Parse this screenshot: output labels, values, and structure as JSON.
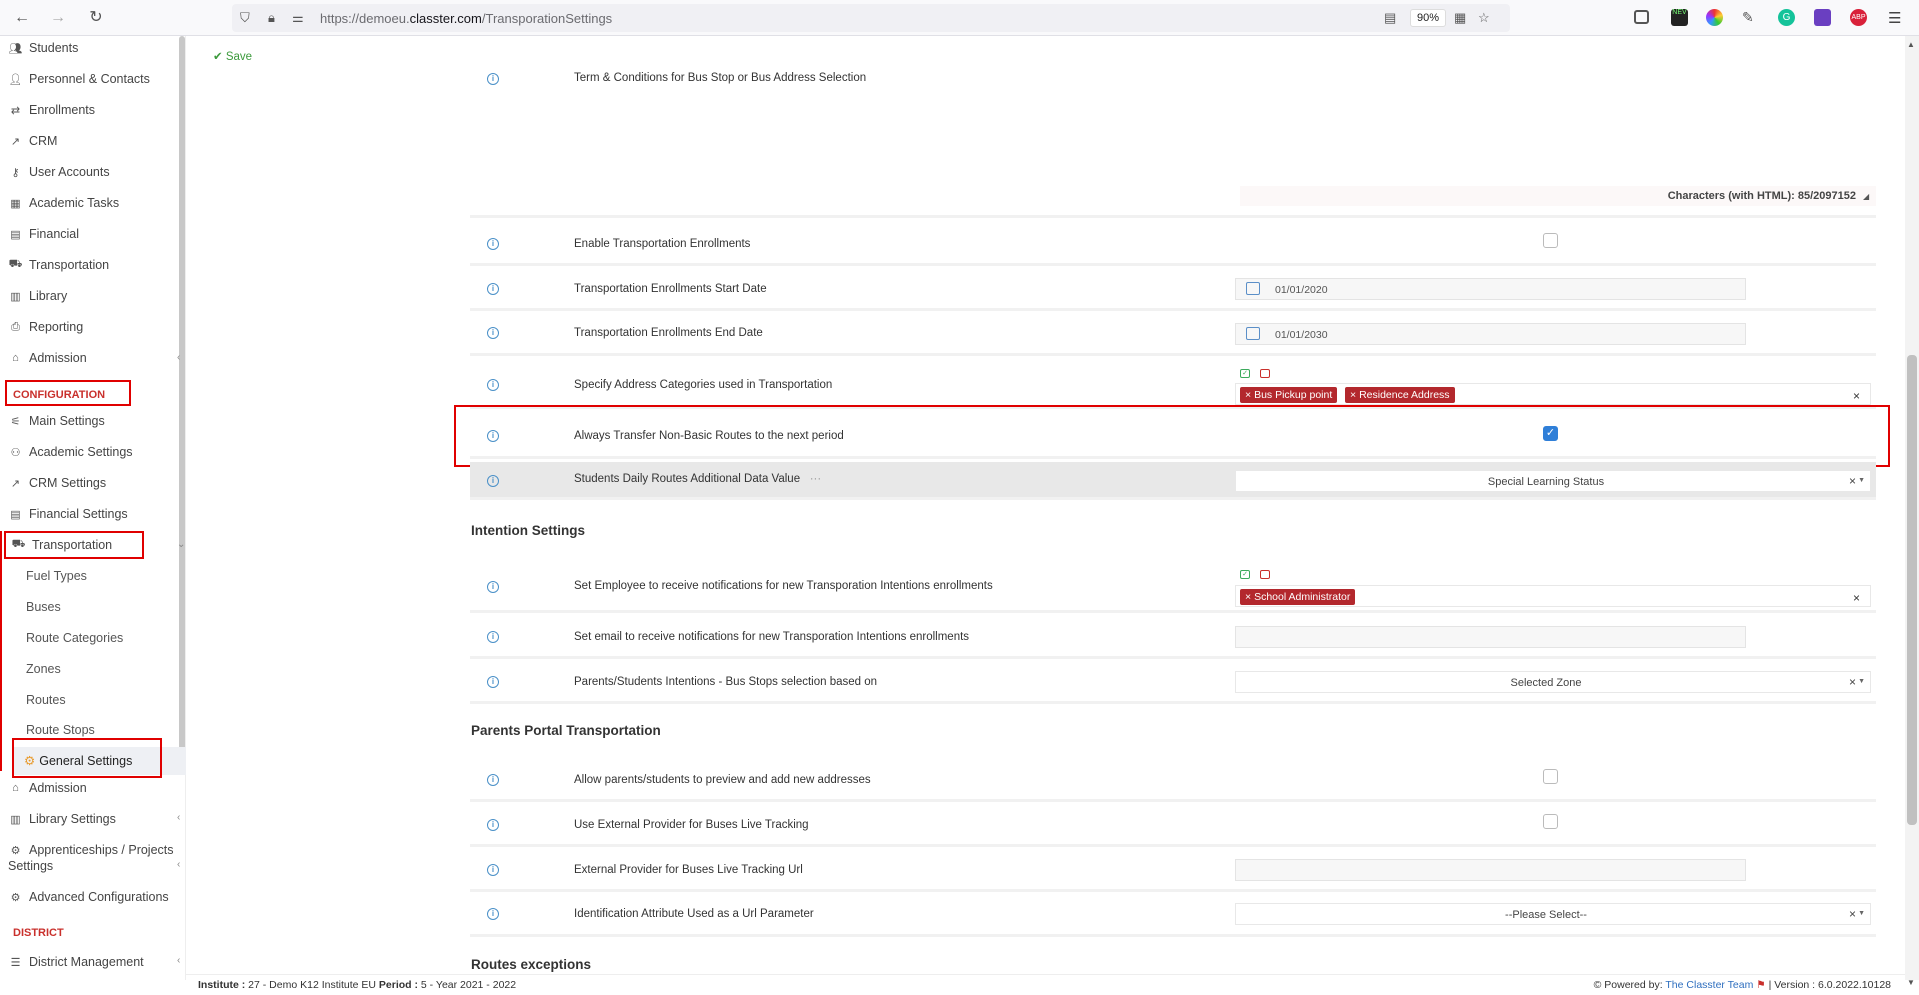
{
  "browser": {
    "url_prefix": "https://demoeu.",
    "url_domain": "classter.com",
    "url_path": "/TransporationSettings",
    "zoom": "90%",
    "ext_new_badge": "NEV",
    "ext_abp": "ABP"
  },
  "sidebar": {
    "items": [
      {
        "label": "Students",
        "icon": "students-icon"
      },
      {
        "label": "Personnel & Contacts",
        "icon": "personnel-icon"
      },
      {
        "label": "Enrollments",
        "icon": "enrollments-icon"
      },
      {
        "label": "CRM",
        "icon": "crm-icon"
      },
      {
        "label": "User Accounts",
        "icon": "key-icon"
      },
      {
        "label": "Academic Tasks",
        "icon": "grid-icon"
      },
      {
        "label": "Financial",
        "icon": "financial-icon"
      },
      {
        "label": "Transportation",
        "icon": "bus-icon"
      },
      {
        "label": "Library",
        "icon": "library-icon"
      },
      {
        "label": "Reporting",
        "icon": "printer-icon"
      },
      {
        "label": "Admission",
        "icon": "institution-icon"
      }
    ],
    "configuration_label": "CONFIGURATION",
    "config_items": [
      {
        "label": "Main Settings"
      },
      {
        "label": "Academic Settings"
      },
      {
        "label": "CRM Settings"
      },
      {
        "label": "Financial Settings"
      },
      {
        "label": "Transportation"
      }
    ],
    "transport_subitems": [
      "Fuel Types",
      "Buses",
      "Route Categories",
      "Zones",
      "Routes",
      "Route Stops",
      "General Settings"
    ],
    "after_items": [
      {
        "label": "Admission"
      },
      {
        "label": "Library Settings"
      },
      {
        "label": "Apprenticeships / Projects"
      },
      {
        "label": "Settings"
      },
      {
        "label": "Advanced Configurations"
      }
    ],
    "district_label": "DISTRICT",
    "district_item": "District Management"
  },
  "toolbar": {
    "save_label": "Save"
  },
  "settings": {
    "terms_label": "Term & Conditions for Bus Stop or Bus Address Selection",
    "char_count": "Characters (with HTML): 85/2097152",
    "enable_enrollments": "Enable Transportation Enrollments",
    "start_date_label": "Transportation Enrollments Start Date",
    "start_date_value": "01/01/2020",
    "end_date_label": "Transportation Enrollments End Date",
    "end_date_value": "01/01/2030",
    "address_categories_label": "Specify Address Categories used in Transportation",
    "address_tags": [
      "Bus Pickup point",
      "Residence Address"
    ],
    "always_transfer_label": "Always Transfer Non-Basic Routes to the next period",
    "always_transfer_checked": true,
    "daily_routes_label": "Students Daily Routes Additional Data Value",
    "daily_routes_dots": "···",
    "daily_routes_value": "Special Learning Status"
  },
  "intention": {
    "heading": "Intention Settings",
    "employee_label": "Set Employee to receive notifications for new Transporation Intentions enrollments",
    "employee_tags": [
      "School Administrator"
    ],
    "email_label": "Set email to receive notifications for new Transporation Intentions enrollments",
    "bus_stops_label": "Parents/Students Intentions - Bus Stops selection based on",
    "bus_stops_value": "Selected Zone"
  },
  "parents_portal": {
    "heading": "Parents Portal Transportation",
    "allow_preview_label": "Allow parents/students to preview and add new addresses",
    "external_provider_label": "Use External Provider for Buses Live Tracking",
    "external_url_label": "External Provider for Buses Live Tracking Url",
    "id_attribute_label": "Identification Attribute Used as a Url Parameter",
    "id_attribute_value": "--Please Select--"
  },
  "routes_exceptions": {
    "heading": "Routes exceptions"
  },
  "footer": {
    "institute_key": "Institute :",
    "institute_value": "27 - Demo K12 Institute EU",
    "period_key": "Period :",
    "period_value": "5 - Year 2021 - 2022",
    "powered_by": "Powered by:",
    "team": "The Classter Team",
    "version": "| Version : 6.0.2022.10128"
  },
  "colors": {
    "accent_red": "#e00000",
    "tag_red": "#b3282d",
    "check_blue": "#2f7fd8",
    "save_green": "#3c9a3c"
  }
}
